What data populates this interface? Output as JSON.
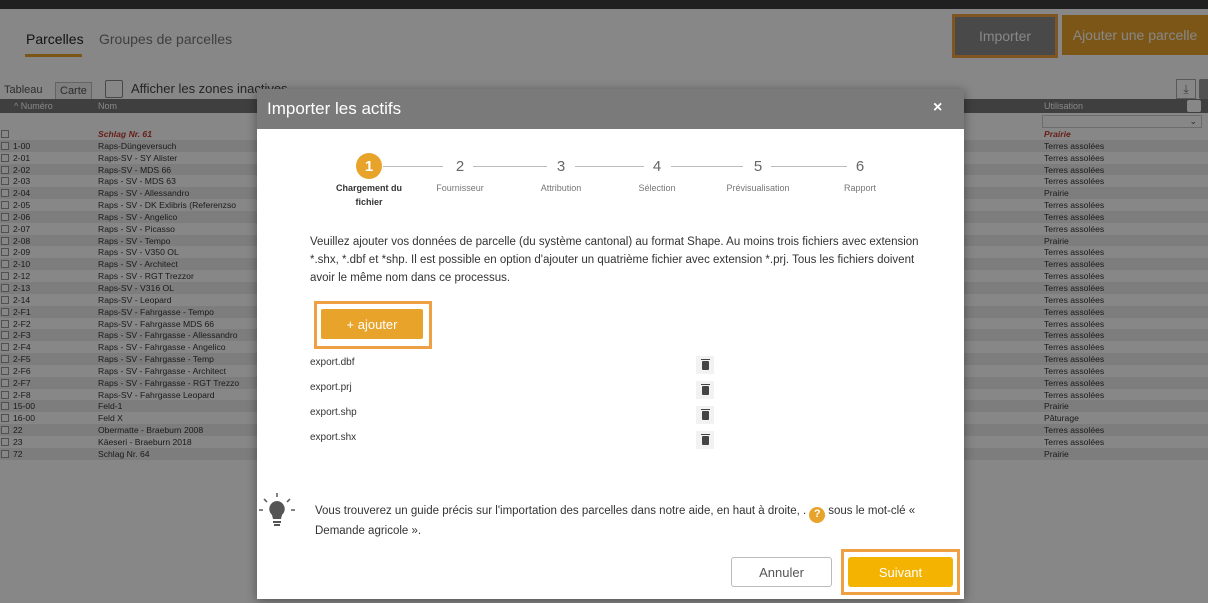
{
  "header": {
    "tabs": [
      {
        "label": "Parcelles",
        "active": true
      },
      {
        "label": "Groupes de parcelles",
        "active": false
      }
    ],
    "import_button": "Importer",
    "add_parcel_button": "Ajouter une parcelle"
  },
  "toolbar": {
    "view_table": "Tableau",
    "view_map": "Carte",
    "show_inactive_label": "Afficher les zones inactives"
  },
  "table": {
    "columns": {
      "number": "Numéro",
      "name": "Nom",
      "usage": "Utilisation"
    },
    "rows": [
      {
        "number": "",
        "name": "Schlag Nr. 61",
        "usage": "Prairie",
        "highlight": true
      },
      {
        "number": "1-00",
        "name": "Raps-Düngeversuch",
        "usage": "Terres assolées"
      },
      {
        "number": "2-01",
        "name": "Raps-SV - SY Alister",
        "usage": "Terres assolées"
      },
      {
        "number": "2-02",
        "name": "Raps-SV - MDS 66",
        "usage": "Terres assolées"
      },
      {
        "number": "2-03",
        "name": "Raps - SV - MDS 63",
        "usage": "Terres assolées"
      },
      {
        "number": "2-04",
        "name": "Raps - SV - Allessandro",
        "usage": "Prairie"
      },
      {
        "number": "2-05",
        "name": "Raps - SV - DK Exlibris (Referenzso",
        "usage": "Terres assolées"
      },
      {
        "number": "2-06",
        "name": "Raps - SV - Angelico",
        "usage": "Terres assolées"
      },
      {
        "number": "2-07",
        "name": "Raps - SV - Picasso",
        "usage": "Terres assolées"
      },
      {
        "number": "2-08",
        "name": "Raps - SV - Tempo",
        "usage": "Prairie"
      },
      {
        "number": "2-09",
        "name": "Raps - SV - V350 OL",
        "usage": "Terres assolées"
      },
      {
        "number": "2-10",
        "name": "Raps - SV - Architect",
        "usage": "Terres assolées"
      },
      {
        "number": "2-12",
        "name": "Raps - SV - RGT Trezzor",
        "usage": "Terres assolées"
      },
      {
        "number": "2-13",
        "name": "Raps-SV - V316 OL",
        "usage": "Terres assolées"
      },
      {
        "number": "2-14",
        "name": "Raps-SV - Leopard",
        "usage": "Terres assolées"
      },
      {
        "number": "2-F1",
        "name": "Raps-SV - Fahrgasse - Tempo",
        "usage": "Terres assolées"
      },
      {
        "number": "2-F2",
        "name": "Raps-SV - Fahrgasse MDS 66",
        "usage": "Terres assolées"
      },
      {
        "number": "2-F3",
        "name": "Raps - SV - Fahrgasse - Allessandro",
        "usage": "Terres assolées"
      },
      {
        "number": "2-F4",
        "name": "Raps - SV - Fahrgasse - Angelico",
        "usage": "Terres assolées"
      },
      {
        "number": "2-F5",
        "name": "Raps - SV - Fahrgasse - Temp",
        "usage": "Terres assolées"
      },
      {
        "number": "2-F6",
        "name": "Raps - SV - Fahrgasse - Architect",
        "usage": "Terres assolées"
      },
      {
        "number": "2-F7",
        "name": "Raps - SV - Fahrgasse - RGT Trezzo",
        "usage": "Terres assolées"
      },
      {
        "number": "2-F8",
        "name": "Raps-SV - Fahrgasse Leopard",
        "usage": "Terres assolées"
      },
      {
        "number": "15-00",
        "name": "Feld-1",
        "usage": "Prairie"
      },
      {
        "number": "16-00",
        "name": "Feld X",
        "usage": "Pâturage"
      },
      {
        "number": "22",
        "name": "Obermatte - Braeburn 2008",
        "usage": "Terres assolées"
      },
      {
        "number": "23",
        "name": "Käeseri - Braeburn 2018",
        "usage": "Terres assolées"
      },
      {
        "number": "72",
        "name": "Schlag Nr. 64",
        "usage": "Prairie"
      }
    ]
  },
  "modal": {
    "title": "Importer les actifs",
    "close": "×",
    "steps": [
      {
        "num": "1",
        "label": "Chargement du fichier",
        "active": true
      },
      {
        "num": "2",
        "label": "Fournisseur",
        "active": false
      },
      {
        "num": "3",
        "label": "Attribution",
        "active": false
      },
      {
        "num": "4",
        "label": "Sélection",
        "active": false
      },
      {
        "num": "5",
        "label": "Prévisualisation",
        "active": false
      },
      {
        "num": "6",
        "label": "Rapport",
        "active": false
      }
    ],
    "description": "Veuillez ajouter vos données de parcelle (du système cantonal) au format Shape. Au moins trois fichiers avec extension *.shx, *.dbf et *shp. Il est possible en option d'ajouter un quatrième fichier avec extension *.prj. Tous les fichiers doivent avoir le même nom dans ce processus.",
    "add_button": "+ ajouter",
    "files": [
      "export.dbf",
      "export.prj",
      "export.shp",
      "export.shx"
    ],
    "hint_before": "Vous trouverez un guide précis sur l'importation des parcelles dans notre aide, en haut à droite, .",
    "hint_help_symbol": "?",
    "hint_after": "sous le mot-clé « Demande agricole ».",
    "cancel_button": "Annuler",
    "next_button": "Suivant"
  },
  "colors": {
    "accent": "#e8a32a",
    "highlight_border": "#f0a044",
    "modal_header": "#7a7a7a",
    "red_text": "#c23b2e"
  }
}
